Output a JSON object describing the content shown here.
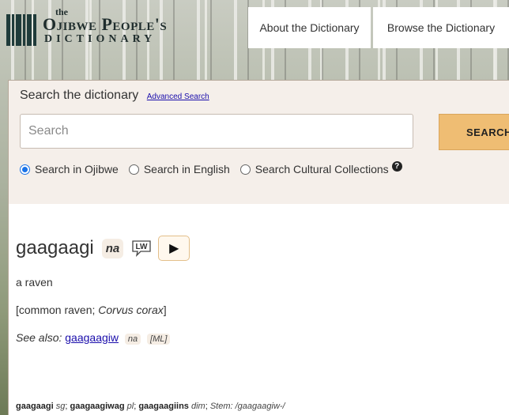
{
  "header": {
    "logo_the": "the",
    "logo_title": "Ojibwe People's",
    "logo_subtitle": "DICTIONARY",
    "nav": [
      {
        "label": "About the Dictionary"
      },
      {
        "label": "Browse the Dictionary"
      }
    ]
  },
  "search": {
    "heading": "Search the dictionary",
    "advanced_link": "Advanced Search",
    "placeholder": "Search",
    "button_label": "SEARCH",
    "options": [
      {
        "label": "Search in Ojibwe",
        "checked": true
      },
      {
        "label": "Search in English",
        "checked": false
      },
      {
        "label": "Search Cultural Collections",
        "checked": false
      }
    ]
  },
  "entry": {
    "headword": "gaagaagi",
    "pos": "na",
    "lw_label": "LW",
    "play_symbol": "▶",
    "gloss": "a raven",
    "scientific_prefix": "[common raven; ",
    "scientific_name": "Corvus corax",
    "scientific_suffix": "]",
    "see_also_label": "See also:",
    "see_also_word": "gaagaagiw",
    "see_also_pos": "na",
    "see_also_source": "[ML]",
    "forms": {
      "sg_word": "gaagaagi",
      "sg_label": "sg",
      "pl_word": "gaagaagiwag",
      "pl_label": "pl",
      "dim_word": "gaagaagiins",
      "dim_label": "dim",
      "stem": "Stem: /gaagaagiw-/"
    }
  }
}
